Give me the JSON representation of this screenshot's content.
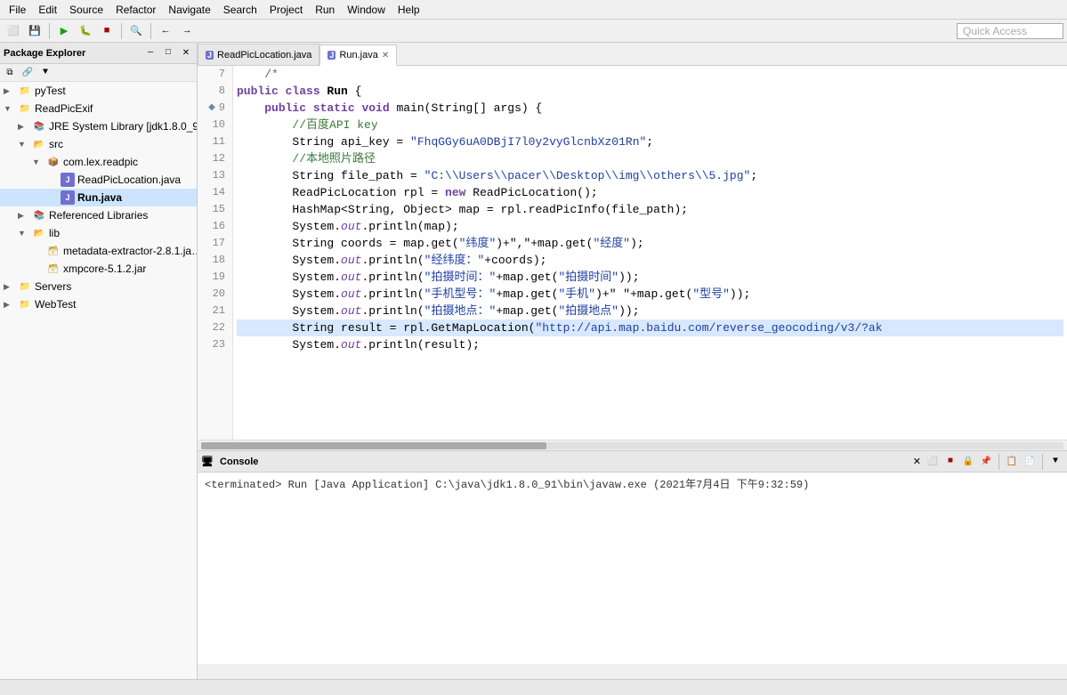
{
  "menubar": {
    "items": [
      "File",
      "Edit",
      "Source",
      "Refactor",
      "Navigate",
      "Search",
      "Project",
      "Run",
      "Window",
      "Help"
    ]
  },
  "toolbar": {
    "quick_access_placeholder": "Quick Access"
  },
  "package_explorer": {
    "title": "Package Explorer",
    "tree": [
      {
        "id": "pyTest",
        "label": "pyTest",
        "indent": 0,
        "arrow": "▶",
        "icon": "📁",
        "bold": false
      },
      {
        "id": "readPicExif",
        "label": "ReadPicExif",
        "indent": 0,
        "arrow": "▼",
        "icon": "📁",
        "bold": false
      },
      {
        "id": "jre",
        "label": "JRE System Library [jdk1.8.0_9…",
        "indent": 1,
        "arrow": "▶",
        "icon": "📚",
        "bold": false
      },
      {
        "id": "src",
        "label": "src",
        "indent": 1,
        "arrow": "▼",
        "icon": "📂",
        "bold": false
      },
      {
        "id": "com.lex.readpic",
        "label": "com.lex.readpic",
        "indent": 2,
        "arrow": "▼",
        "icon": "📦",
        "bold": false
      },
      {
        "id": "ReadPicLocation",
        "label": "ReadPicLocation.java",
        "indent": 3,
        "arrow": "",
        "icon": "J",
        "bold": false
      },
      {
        "id": "RunJava",
        "label": "Run.java",
        "indent": 3,
        "arrow": "",
        "icon": "J",
        "bold": true,
        "selected": true
      },
      {
        "id": "refLibs",
        "label": "Referenced Libraries",
        "indent": 1,
        "arrow": "▶",
        "icon": "📚",
        "bold": false
      },
      {
        "id": "lib",
        "label": "lib",
        "indent": 1,
        "arrow": "▼",
        "icon": "📂",
        "bold": false
      },
      {
        "id": "metadata",
        "label": "metadata-extractor-2.8.1.ja…",
        "indent": 2,
        "arrow": "",
        "icon": "🗃",
        "bold": false
      },
      {
        "id": "xmpcore",
        "label": "xmpcore-5.1.2.jar",
        "indent": 2,
        "arrow": "",
        "icon": "🗃",
        "bold": false
      },
      {
        "id": "servers",
        "label": "Servers",
        "indent": 0,
        "arrow": "▶",
        "icon": "📁",
        "bold": false
      },
      {
        "id": "webTest",
        "label": "WebTest",
        "indent": 0,
        "arrow": "▶",
        "icon": "📁",
        "bold": false
      }
    ]
  },
  "editor": {
    "tabs": [
      {
        "label": "ReadPicLocation.java",
        "icon": "J",
        "active": false,
        "closeable": false
      },
      {
        "label": "Run.java",
        "icon": "J",
        "active": true,
        "closeable": true
      }
    ],
    "lines": [
      {
        "num": "",
        "content_parts": [
          {
            "text": "/*",
            "cls": "comment"
          }
        ],
        "highlighted": false,
        "arrow": ""
      },
      {
        "num": "8",
        "content_parts": [
          {
            "text": "public ",
            "cls": "kw"
          },
          {
            "text": "class ",
            "cls": "kw"
          },
          {
            "text": "Run {",
            "cls": "normal"
          }
        ],
        "highlighted": false,
        "arrow": ""
      },
      {
        "num": "9",
        "content_parts": [
          {
            "text": "    ",
            "cls": "normal"
          },
          {
            "text": "public ",
            "cls": "kw"
          },
          {
            "text": "static ",
            "cls": "kw"
          },
          {
            "text": "void ",
            "cls": "kw"
          },
          {
            "text": "main(String[] args) {",
            "cls": "normal"
          }
        ],
        "highlighted": false,
        "arrow": "◆"
      },
      {
        "num": "10",
        "content_parts": [
          {
            "text": "        ",
            "cls": "normal"
          },
          {
            "text": "//百度API key",
            "cls": "comment"
          }
        ],
        "highlighted": false,
        "arrow": ""
      },
      {
        "num": "11",
        "content_parts": [
          {
            "text": "        String api_key = ",
            "cls": "normal"
          },
          {
            "text": "\"FhqGGy6uA0DBjI7l0y2vyGlcnbXz01Rn\"",
            "cls": "str"
          },
          {
            "text": ";",
            "cls": "normal"
          }
        ],
        "highlighted": false,
        "arrow": ""
      },
      {
        "num": "12",
        "content_parts": [
          {
            "text": "        ",
            "cls": "normal"
          },
          {
            "text": "//本地照片路径",
            "cls": "comment"
          }
        ],
        "highlighted": false,
        "arrow": ""
      },
      {
        "num": "13",
        "content_parts": [
          {
            "text": "        String file_path = ",
            "cls": "normal"
          },
          {
            "text": "\"C:\\\\Users\\\\pacer\\\\Desktop\\\\img\\\\others\\\\5.jpg\"",
            "cls": "str"
          },
          {
            "text": ";",
            "cls": "normal"
          }
        ],
        "highlighted": false,
        "arrow": ""
      },
      {
        "num": "14",
        "content_parts": [
          {
            "text": "        ReadPicLocation rpl = ",
            "cls": "normal"
          },
          {
            "text": "new ",
            "cls": "kw"
          },
          {
            "text": "ReadPicLocation();",
            "cls": "normal"
          }
        ],
        "highlighted": false,
        "arrow": ""
      },
      {
        "num": "15",
        "content_parts": [
          {
            "text": "        HashMap<String, Object> map = rpl.readPicInfo(file_path);",
            "cls": "normal"
          }
        ],
        "highlighted": false,
        "arrow": ""
      },
      {
        "num": "16",
        "content_parts": [
          {
            "text": "        System.",
            "cls": "normal"
          },
          {
            "text": "out",
            "cls": "out"
          },
          {
            "text": ".println(map);",
            "cls": "normal"
          }
        ],
        "highlighted": false,
        "arrow": ""
      },
      {
        "num": "17",
        "content_parts": [
          {
            "text": "        String coords = map.get(",
            "cls": "normal"
          },
          {
            "text": "\"纬度\"",
            "cls": "str"
          },
          {
            "text": ")+\",\"+map.get(",
            "cls": "normal"
          },
          {
            "text": "\"经度\"",
            "cls": "str"
          },
          {
            "text": ");",
            "cls": "normal"
          }
        ],
        "highlighted": false,
        "arrow": ""
      },
      {
        "num": "18",
        "content_parts": [
          {
            "text": "        System.",
            "cls": "normal"
          },
          {
            "text": "out",
            "cls": "out"
          },
          {
            "text": ".println(",
            "cls": "normal"
          },
          {
            "text": "\"经纬度：\"",
            "cls": "str"
          },
          {
            "text": "+coords);",
            "cls": "normal"
          }
        ],
        "highlighted": false,
        "arrow": ""
      },
      {
        "num": "19",
        "content_parts": [
          {
            "text": "        System.",
            "cls": "normal"
          },
          {
            "text": "out",
            "cls": "out"
          },
          {
            "text": ".println(",
            "cls": "normal"
          },
          {
            "text": "\"拍摄时间：\"",
            "cls": "str"
          },
          {
            "text": "+map.get(",
            "cls": "normal"
          },
          {
            "text": "\"拍摄时间\"",
            "cls": "str"
          },
          {
            "text": "));",
            "cls": "normal"
          }
        ],
        "highlighted": false,
        "arrow": ""
      },
      {
        "num": "20",
        "content_parts": [
          {
            "text": "        System.",
            "cls": "normal"
          },
          {
            "text": "out",
            "cls": "out"
          },
          {
            "text": ".println(",
            "cls": "normal"
          },
          {
            "text": "\"手机型号：\"",
            "cls": "str"
          },
          {
            "text": "+map.get(",
            "cls": "normal"
          },
          {
            "text": "\"手机\"",
            "cls": "str"
          },
          {
            "text": ")+\" \"+map.get(",
            "cls": "normal"
          },
          {
            "text": "\"型号\"",
            "cls": "str"
          },
          {
            "text": "));",
            "cls": "normal"
          }
        ],
        "highlighted": false,
        "arrow": ""
      },
      {
        "num": "21",
        "content_parts": [
          {
            "text": "        System.",
            "cls": "normal"
          },
          {
            "text": "out",
            "cls": "out"
          },
          {
            "text": ".println(",
            "cls": "normal"
          },
          {
            "text": "\"拍摄地点：\"",
            "cls": "str"
          },
          {
            "text": "+map.get(",
            "cls": "normal"
          },
          {
            "text": "\"拍摄地点\"",
            "cls": "str"
          },
          {
            "text": "));",
            "cls": "normal"
          }
        ],
        "highlighted": false,
        "arrow": ""
      },
      {
        "num": "22",
        "content_parts": [
          {
            "text": "        String result = rpl.GetMapLocation(",
            "cls": "normal"
          },
          {
            "text": "\"http://api.map.baidu.com/reverse_geocoding/v3/?ak",
            "cls": "str"
          }
        ],
        "highlighted": true,
        "arrow": ""
      },
      {
        "num": "23",
        "content_parts": [
          {
            "text": "        System.",
            "cls": "normal"
          },
          {
            "text": "out",
            "cls": "out"
          },
          {
            "text": ".println(result);",
            "cls": "normal"
          }
        ],
        "highlighted": false,
        "arrow": ""
      }
    ]
  },
  "console": {
    "title": "Console",
    "terminated_text": "<terminated> Run [Java Application] C:\\java\\jdk1.8.0_91\\bin\\javaw.exe (2021年7月4日 下午9:32:59)"
  },
  "status_bar": {
    "text": ""
  }
}
